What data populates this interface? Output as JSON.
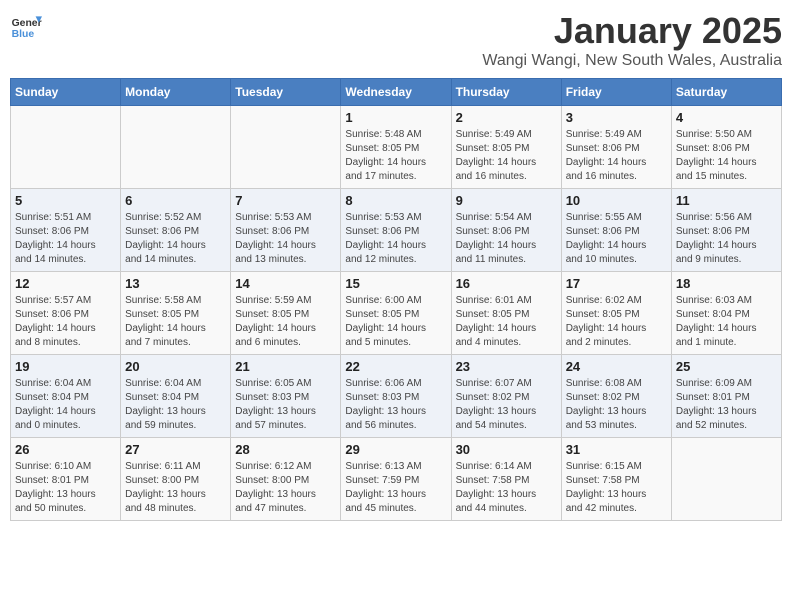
{
  "app": {
    "logo_general": "General",
    "logo_blue": "Blue"
  },
  "header": {
    "title": "January 2025",
    "subtitle": "Wangi Wangi, New South Wales, Australia"
  },
  "weekdays": [
    "Sunday",
    "Monday",
    "Tuesday",
    "Wednesday",
    "Thursday",
    "Friday",
    "Saturday"
  ],
  "weeks": [
    [
      {
        "day": "",
        "info": ""
      },
      {
        "day": "",
        "info": ""
      },
      {
        "day": "",
        "info": ""
      },
      {
        "day": "1",
        "info": "Sunrise: 5:48 AM\nSunset: 8:05 PM\nDaylight: 14 hours\nand 17 minutes."
      },
      {
        "day": "2",
        "info": "Sunrise: 5:49 AM\nSunset: 8:05 PM\nDaylight: 14 hours\nand 16 minutes."
      },
      {
        "day": "3",
        "info": "Sunrise: 5:49 AM\nSunset: 8:06 PM\nDaylight: 14 hours\nand 16 minutes."
      },
      {
        "day": "4",
        "info": "Sunrise: 5:50 AM\nSunset: 8:06 PM\nDaylight: 14 hours\nand 15 minutes."
      }
    ],
    [
      {
        "day": "5",
        "info": "Sunrise: 5:51 AM\nSunset: 8:06 PM\nDaylight: 14 hours\nand 14 minutes."
      },
      {
        "day": "6",
        "info": "Sunrise: 5:52 AM\nSunset: 8:06 PM\nDaylight: 14 hours\nand 14 minutes."
      },
      {
        "day": "7",
        "info": "Sunrise: 5:53 AM\nSunset: 8:06 PM\nDaylight: 14 hours\nand 13 minutes."
      },
      {
        "day": "8",
        "info": "Sunrise: 5:53 AM\nSunset: 8:06 PM\nDaylight: 14 hours\nand 12 minutes."
      },
      {
        "day": "9",
        "info": "Sunrise: 5:54 AM\nSunset: 8:06 PM\nDaylight: 14 hours\nand 11 minutes."
      },
      {
        "day": "10",
        "info": "Sunrise: 5:55 AM\nSunset: 8:06 PM\nDaylight: 14 hours\nand 10 minutes."
      },
      {
        "day": "11",
        "info": "Sunrise: 5:56 AM\nSunset: 8:06 PM\nDaylight: 14 hours\nand 9 minutes."
      }
    ],
    [
      {
        "day": "12",
        "info": "Sunrise: 5:57 AM\nSunset: 8:06 PM\nDaylight: 14 hours\nand 8 minutes."
      },
      {
        "day": "13",
        "info": "Sunrise: 5:58 AM\nSunset: 8:05 PM\nDaylight: 14 hours\nand 7 minutes."
      },
      {
        "day": "14",
        "info": "Sunrise: 5:59 AM\nSunset: 8:05 PM\nDaylight: 14 hours\nand 6 minutes."
      },
      {
        "day": "15",
        "info": "Sunrise: 6:00 AM\nSunset: 8:05 PM\nDaylight: 14 hours\nand 5 minutes."
      },
      {
        "day": "16",
        "info": "Sunrise: 6:01 AM\nSunset: 8:05 PM\nDaylight: 14 hours\nand 4 minutes."
      },
      {
        "day": "17",
        "info": "Sunrise: 6:02 AM\nSunset: 8:05 PM\nDaylight: 14 hours\nand 2 minutes."
      },
      {
        "day": "18",
        "info": "Sunrise: 6:03 AM\nSunset: 8:04 PM\nDaylight: 14 hours\nand 1 minute."
      }
    ],
    [
      {
        "day": "19",
        "info": "Sunrise: 6:04 AM\nSunset: 8:04 PM\nDaylight: 14 hours\nand 0 minutes."
      },
      {
        "day": "20",
        "info": "Sunrise: 6:04 AM\nSunset: 8:04 PM\nDaylight: 13 hours\nand 59 minutes."
      },
      {
        "day": "21",
        "info": "Sunrise: 6:05 AM\nSunset: 8:03 PM\nDaylight: 13 hours\nand 57 minutes."
      },
      {
        "day": "22",
        "info": "Sunrise: 6:06 AM\nSunset: 8:03 PM\nDaylight: 13 hours\nand 56 minutes."
      },
      {
        "day": "23",
        "info": "Sunrise: 6:07 AM\nSunset: 8:02 PM\nDaylight: 13 hours\nand 54 minutes."
      },
      {
        "day": "24",
        "info": "Sunrise: 6:08 AM\nSunset: 8:02 PM\nDaylight: 13 hours\nand 53 minutes."
      },
      {
        "day": "25",
        "info": "Sunrise: 6:09 AM\nSunset: 8:01 PM\nDaylight: 13 hours\nand 52 minutes."
      }
    ],
    [
      {
        "day": "26",
        "info": "Sunrise: 6:10 AM\nSunset: 8:01 PM\nDaylight: 13 hours\nand 50 minutes."
      },
      {
        "day": "27",
        "info": "Sunrise: 6:11 AM\nSunset: 8:00 PM\nDaylight: 13 hours\nand 48 minutes."
      },
      {
        "day": "28",
        "info": "Sunrise: 6:12 AM\nSunset: 8:00 PM\nDaylight: 13 hours\nand 47 minutes."
      },
      {
        "day": "29",
        "info": "Sunrise: 6:13 AM\nSunset: 7:59 PM\nDaylight: 13 hours\nand 45 minutes."
      },
      {
        "day": "30",
        "info": "Sunrise: 6:14 AM\nSunset: 7:58 PM\nDaylight: 13 hours\nand 44 minutes."
      },
      {
        "day": "31",
        "info": "Sunrise: 6:15 AM\nSunset: 7:58 PM\nDaylight: 13 hours\nand 42 minutes."
      },
      {
        "day": "",
        "info": ""
      }
    ]
  ]
}
